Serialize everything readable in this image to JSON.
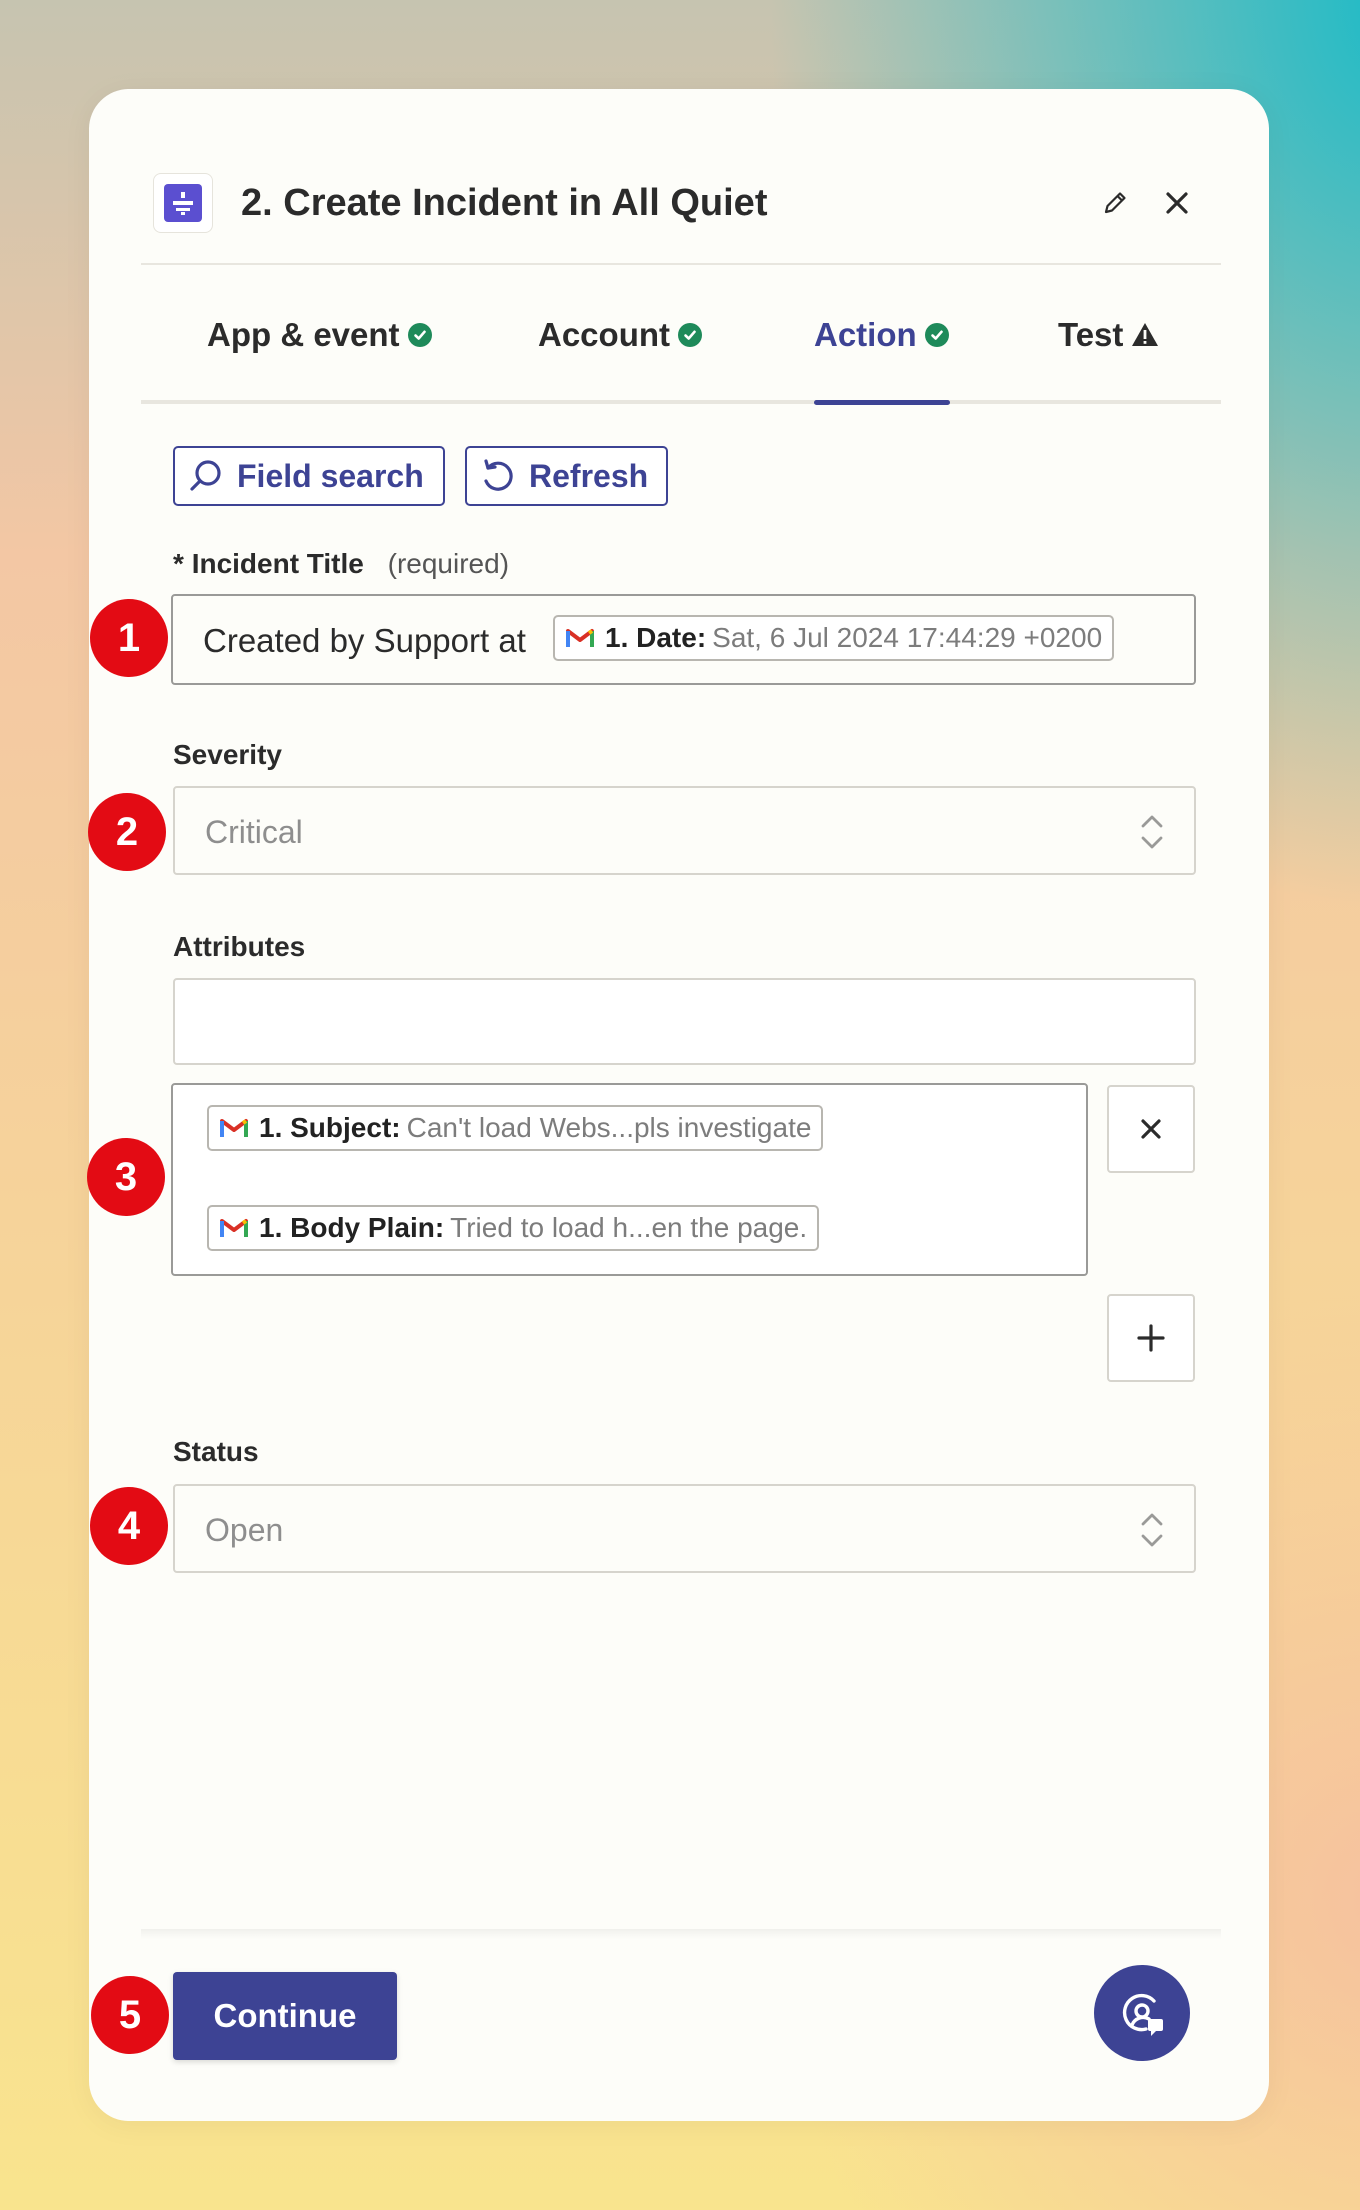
{
  "header": {
    "title": "2. Create Incident in All Quiet",
    "app_icon": "all-quiet-logo",
    "edit_icon": "pencil-icon",
    "close_icon": "close-icon"
  },
  "tabs": [
    {
      "label": "App & event",
      "status": "check-icon"
    },
    {
      "label": "Account",
      "status": "check-icon"
    },
    {
      "label": "Action",
      "status": "check-icon",
      "active": true
    },
    {
      "label": "Test",
      "status": "warning-icon"
    }
  ],
  "toolbar": {
    "field_search_label": "Field search",
    "refresh_label": "Refresh"
  },
  "incident_title": {
    "asterisk": "*",
    "label": "Incident Title",
    "required_text": "(required)",
    "prefix_text": "Created by Support at",
    "token": {
      "source_icon": "gmail-icon",
      "key": "1. Date:",
      "value": "Sat, 6 Jul 2024 17:44:29 +0200"
    }
  },
  "severity": {
    "label": "Severity",
    "value": "Critical"
  },
  "attributes": {
    "label": "Attributes",
    "key_value": "",
    "tokens": [
      {
        "source_icon": "gmail-icon",
        "key": "1. Subject:",
        "value": "Can't load Webs...pls investigate"
      },
      {
        "source_icon": "gmail-icon",
        "key": "1. Body Plain:",
        "value": "Tried to load h...en the  page."
      }
    ]
  },
  "status": {
    "label": "Status",
    "value": "Open"
  },
  "footer": {
    "continue_label": "Continue",
    "help_icon": "support-chat-icon"
  },
  "annotations": [
    "1",
    "2",
    "3",
    "4",
    "5"
  ],
  "colors": {
    "accent": "#3d4394",
    "success": "#1e8a5a",
    "annotation": "#e30b14",
    "app_brand": "#5b4fd0"
  }
}
